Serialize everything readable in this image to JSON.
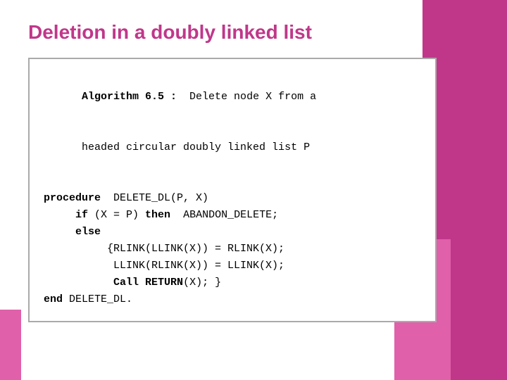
{
  "page": {
    "title": "Deletion in a doubly linked list",
    "title_color": "#c0378a"
  },
  "algorithm": {
    "header_line1": "Algorithm 6.5 :  Delete node X from a",
    "header_line2": "headed circular doubly linked list P",
    "code_lines": [
      "",
      "procedure  DELETE_DL(P, X)",
      "     if (X = P) then  ABANDON_DELETE;",
      "     else",
      "          {RLINK(LLINK(X)) = RLINK(X);",
      "           LLINK(RLINK(X)) = LLINK(X);",
      "           Call RETURN(X); }",
      "end DELETE_DL."
    ]
  }
}
